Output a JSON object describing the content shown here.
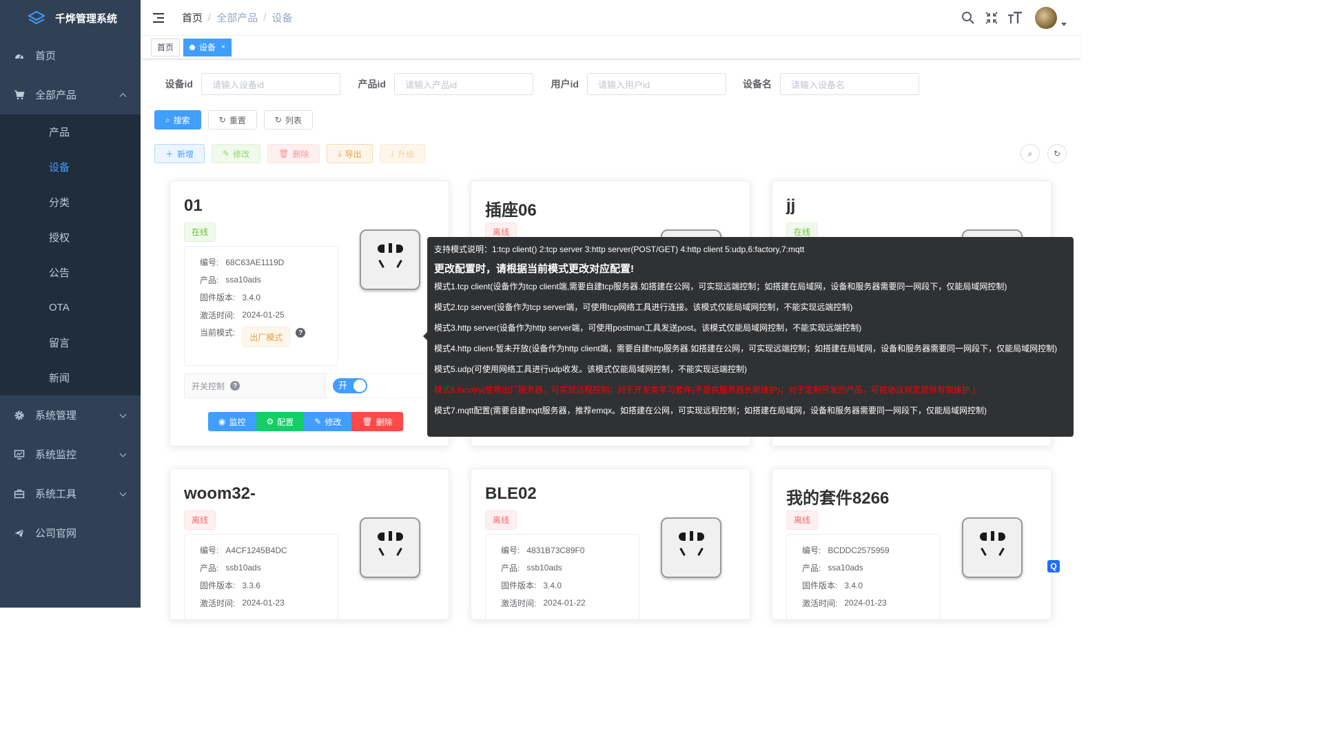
{
  "app": {
    "title": "千烨管理系统"
  },
  "sidebar": {
    "home": "首页",
    "products": "全部产品",
    "sub_items": [
      "产品",
      "设备",
      "分类",
      "授权",
      "公告",
      "OTA",
      "留言",
      "新闻"
    ],
    "system_manage": "系统管理",
    "system_monitor": "系统监控",
    "system_tools": "系统工具",
    "company_site": "公司官网"
  },
  "breadcrumb": [
    "首页",
    "全部产品",
    "设备"
  ],
  "tags": {
    "home": "首页",
    "device": "设备",
    "close": "×"
  },
  "search": {
    "device_id_label": "设备id",
    "device_id_ph": "请输入设备id",
    "product_id_label": "产品id",
    "product_id_ph": "请输入产品id",
    "user_id_label": "用户id",
    "user_id_ph": "请输入用户id",
    "device_name_label": "设备名",
    "device_name_ph": "请输入设备名"
  },
  "buttons": {
    "search": "搜索",
    "reset": "重置",
    "list": "列表",
    "add": "新增",
    "edit": "修改",
    "delete": "删除",
    "export": "导出",
    "upgrade": "升级"
  },
  "card_labels": {
    "serial": "编号:",
    "product": "产品:",
    "firmware": "固件版本:",
    "activated": "激活时间:",
    "mode": "当前模式:",
    "switch_ctrl": "开关控制",
    "switch_on": "开",
    "monitor": "监控",
    "config": "配置",
    "edit": "修改",
    "delete": "删除"
  },
  "devices": [
    {
      "name": "01",
      "status": "在线",
      "serial": "68C63AE1119D",
      "product": "ssa10ads",
      "firmware": "3.4.0",
      "activated": "2024-01-25",
      "mode": "出厂模式"
    },
    {
      "name": "插座06",
      "status": "离线"
    },
    {
      "name": "jj",
      "status": "在线"
    },
    {
      "name": "woom32-",
      "status": "离线",
      "serial": "A4CF1245B4DC",
      "product": "ssb10ads",
      "firmware": "3.3.6",
      "activated": "2024-01-23"
    },
    {
      "name": "BLE02",
      "status": "离线",
      "serial": "4831B73C89F0",
      "product": "ssb10ads",
      "firmware": "3.4.0",
      "activated": "2024-01-22"
    },
    {
      "name": "我的套件8266",
      "status": "离线",
      "serial": "BCDDC2575959",
      "product": "ssa10ads",
      "firmware": "3.4.0",
      "activated": "2024-01-23"
    }
  ],
  "tooltip": {
    "line1": "支持模式说明：1:tcp client() 2:tcp server 3:http server(POST/GET) 4:http client 5:udp,6:factory,7:mqtt",
    "head": "更改配置时，请根据当前模式更改对应配置!",
    "m1": "模式1.tcp client(设备作为tcp client端,需要自建tcp服务器.如搭建在公网，可实现远端控制；如搭建在局域网，设备和服务器需要同一网段下，仅能局域网控制)",
    "m2": "模式2.tcp server(设备作为tcp server端，可使用tcp网络工具进行连接。该模式仅能局域网控制，不能实现远端控制)",
    "m3": "模式3.http server(设备作为http server端，可使用postman工具发送post。该模式仅能局域网控制，不能实现远端控制)",
    "m4": "模式4.http client-暂未开放(设备作为http client端，需要自建http服务器.如搭建在公网，可实现远端控制；如搭建在局域网，设备和服务器需要同一网段下，仅能局域网控制)",
    "m5": "模式5.udp(可使用网络工具进行udp收发。该模式仅能局域网控制，不能实现远端控制)",
    "m6": "模式6.facotry(使用出厂服务器，可实现远程控制；对于开发类学习套件(不提供服务器长期维护)；对于定制开发的产品，可按协议规定提供有偿维护.)",
    "m7": "模式7.mqtt配置(需要自建mqtt服务器，推荐emqx。如搭建在公网，可实现远程控制；如搭建在局域网，设备和服务器需要同一网段下，仅能局域网控制)"
  },
  "colors": {
    "sidebar_bg": "#304156",
    "primary": "#409eff",
    "success": "#13ce66",
    "danger": "#ff4949"
  }
}
